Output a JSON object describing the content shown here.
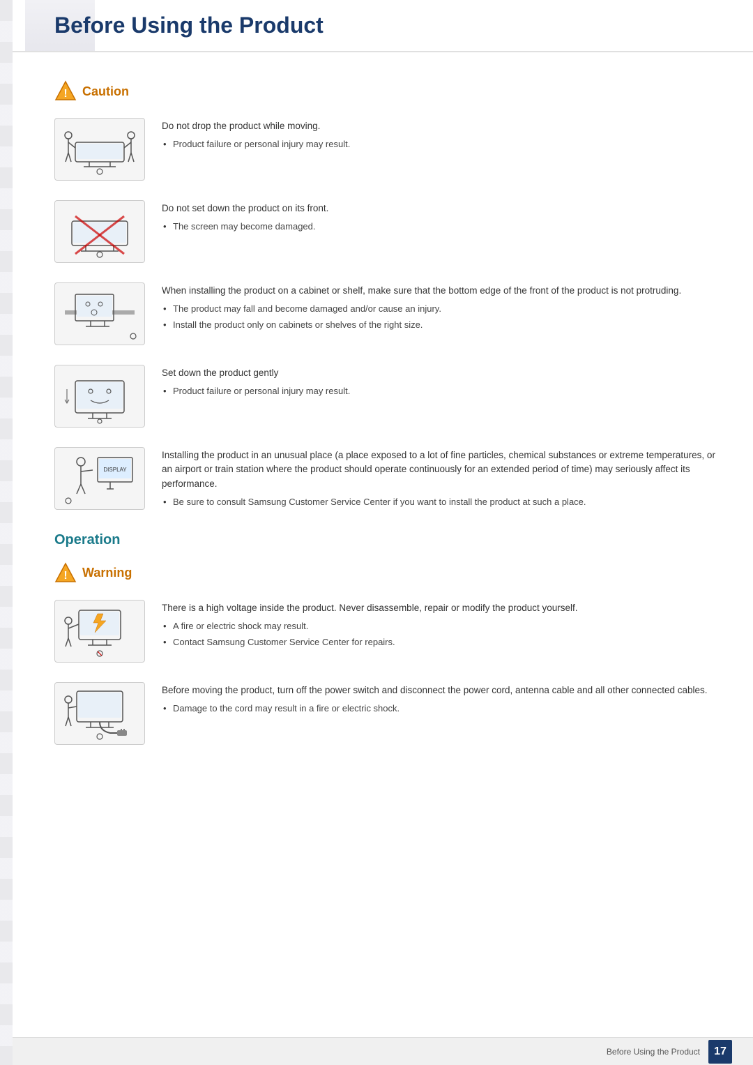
{
  "header": {
    "title": "Before Using the Product"
  },
  "caution_section": {
    "badge_label": "Caution",
    "items": [
      {
        "id": "caution-1",
        "main_text": "Do not drop the product while moving.",
        "bullets": [
          "Product failure or personal injury may result."
        ]
      },
      {
        "id": "caution-2",
        "main_text": "Do not set down the product on its front.",
        "bullets": [
          "The screen may become damaged."
        ]
      },
      {
        "id": "caution-3",
        "main_text": "When installing the product on a cabinet or shelf, make sure that the bottom edge of the front of the product is not protruding.",
        "bullets": [
          "The product may fall and become damaged and/or cause an injury.",
          "Install the product only on cabinets or shelves of the right size."
        ]
      },
      {
        "id": "caution-4",
        "main_text": "Set down the product gently",
        "bullets": [
          "Product failure or personal injury may result."
        ]
      },
      {
        "id": "caution-5",
        "main_text": "Installing the product in an unusual place (a place exposed to a lot of fine particles, chemical substances or extreme temperatures, or an airport or train station where the product should operate continuously for an extended period of time) may seriously affect its performance.",
        "bullets": [
          "Be sure to consult Samsung Customer Service Center if you want to install the product at such a place."
        ]
      }
    ]
  },
  "operation_section": {
    "heading": "Operation"
  },
  "warning_section": {
    "badge_label": "Warning",
    "items": [
      {
        "id": "warning-1",
        "main_text": "There is a high voltage inside the product. Never disassemble, repair or modify the product yourself.",
        "bullets": [
          "A fire or electric shock may result.",
          "Contact Samsung Customer Service Center for repairs."
        ]
      },
      {
        "id": "warning-2",
        "main_text": "Before moving the product, turn off the power switch and disconnect the power cord, antenna cable and all other connected cables.",
        "bullets": [
          "Damage to the cord may result in a fire or electric shock."
        ]
      }
    ]
  },
  "footer": {
    "text": "Before Using the Product",
    "page_number": "17"
  }
}
